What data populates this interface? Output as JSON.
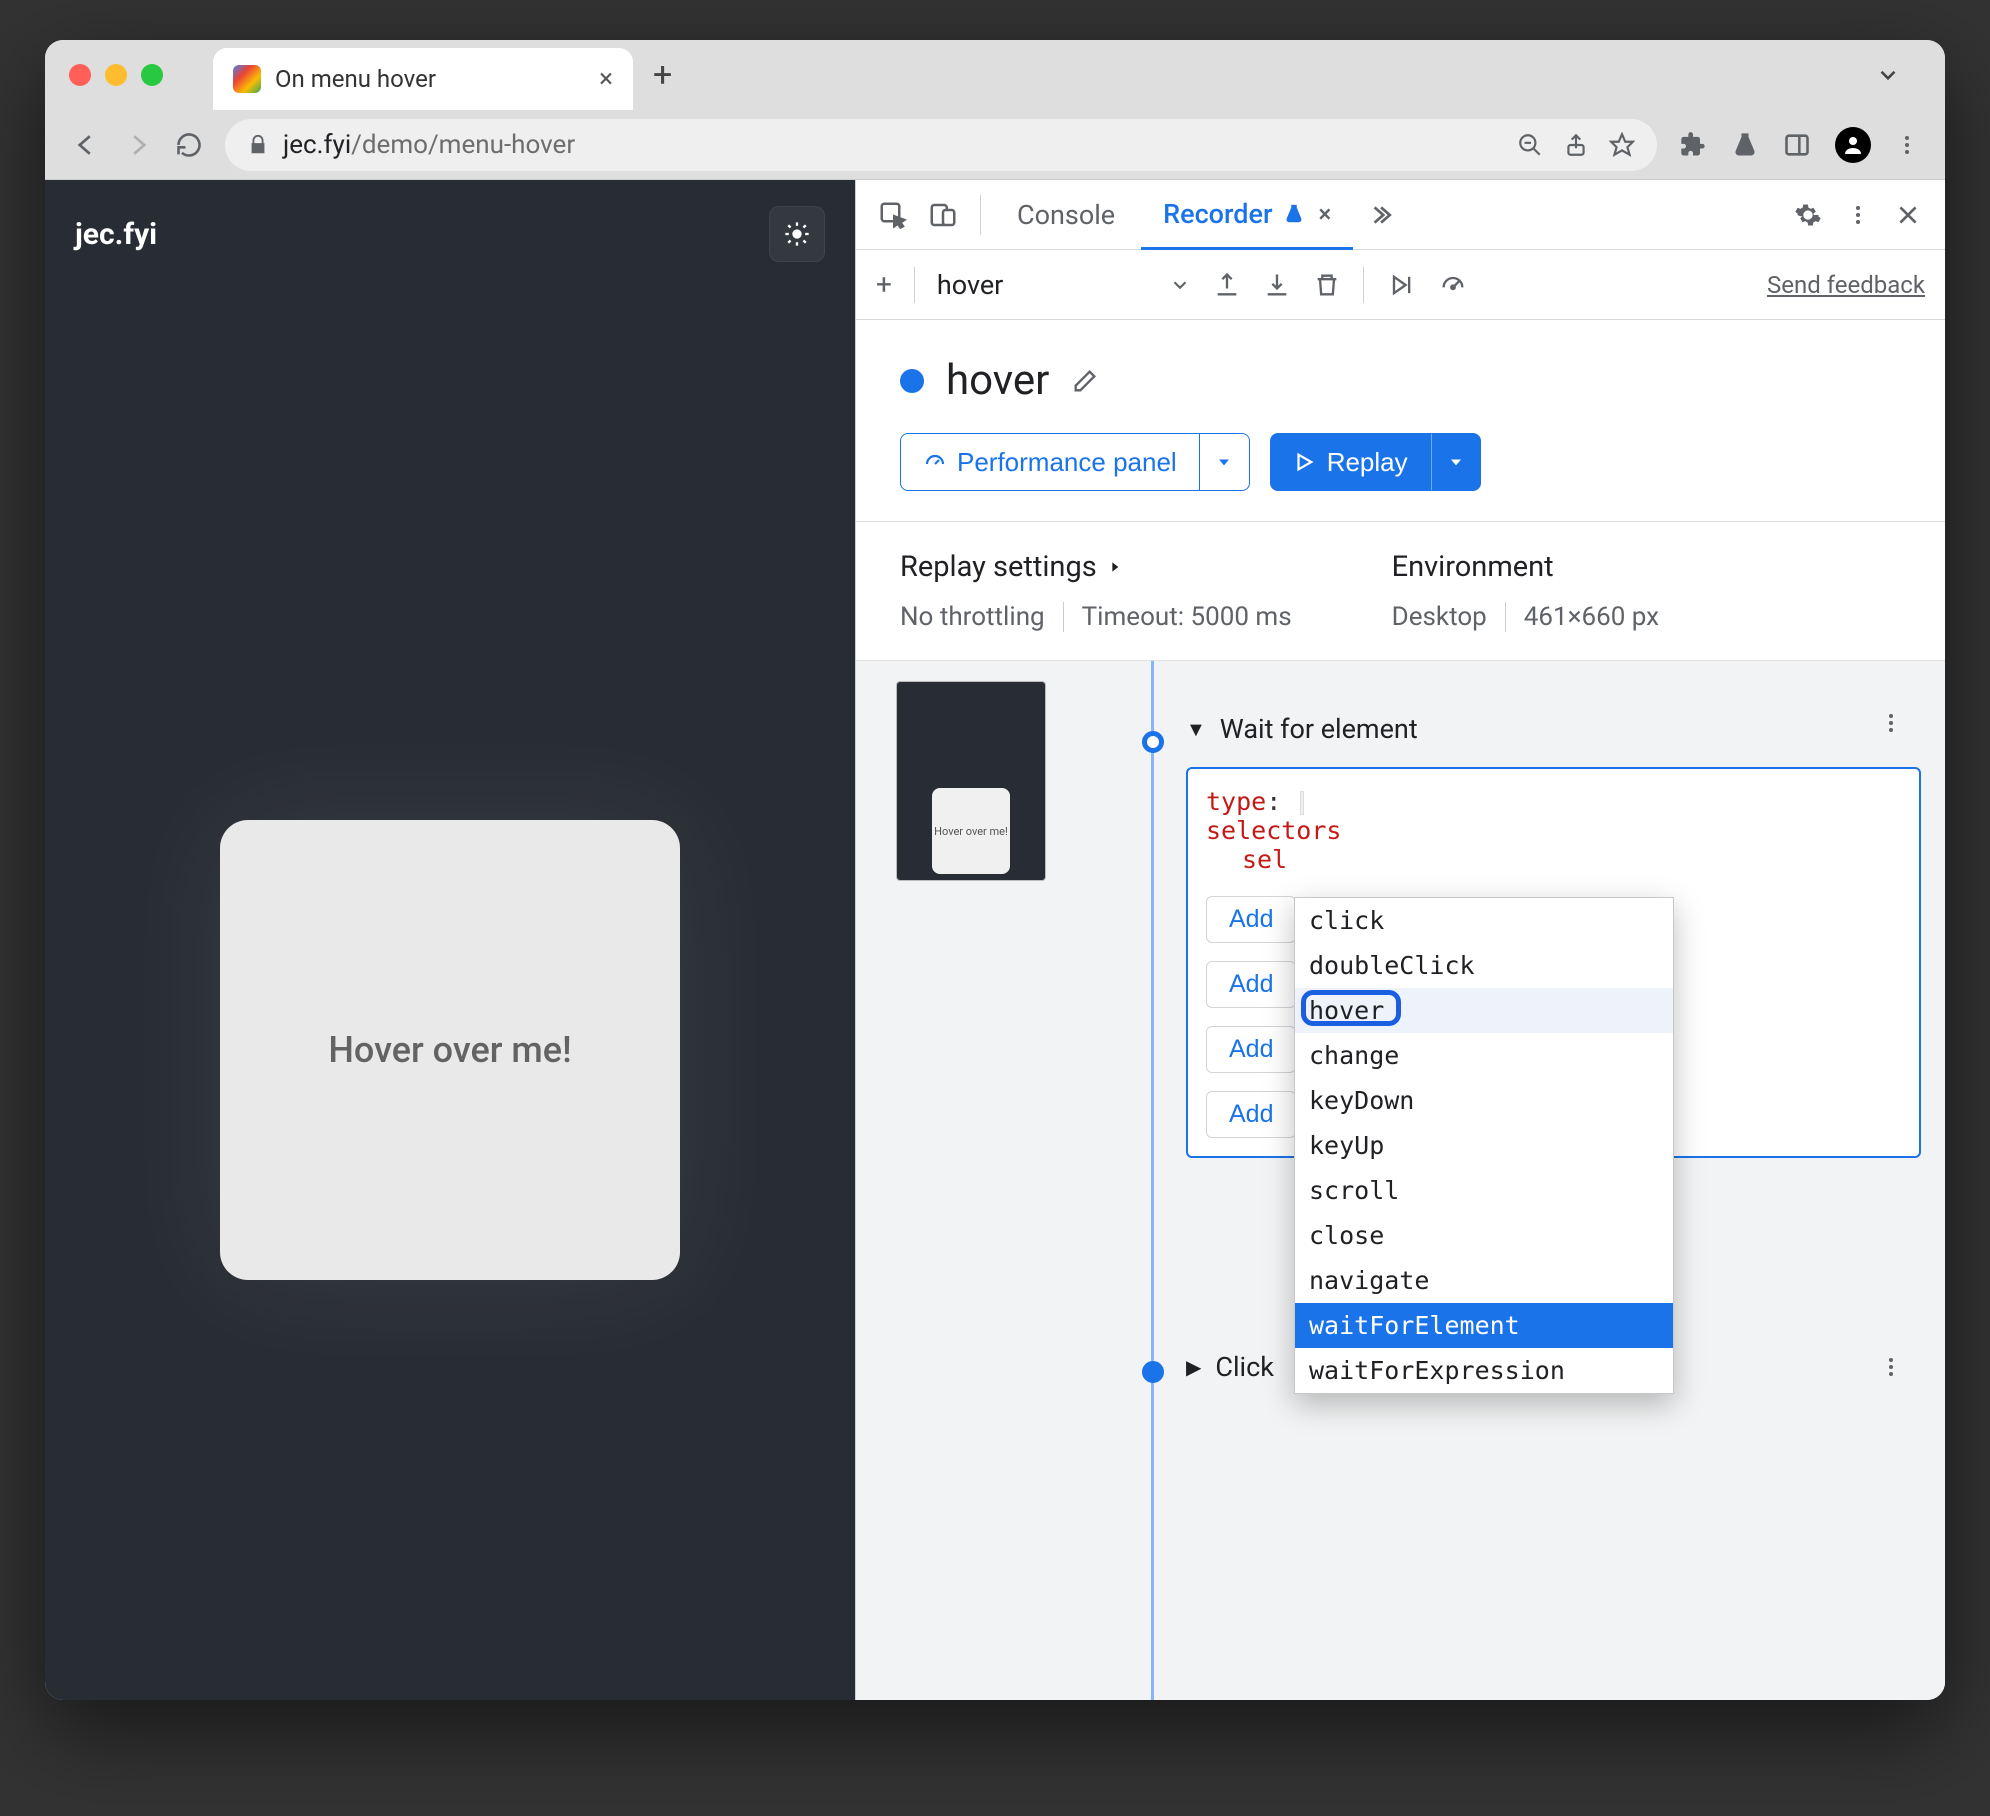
{
  "browser": {
    "tab_title": "On menu hover",
    "url_host": "jec.fyi",
    "url_path": "/demo/menu-hover"
  },
  "page": {
    "site_name": "jec.fyi",
    "card_text": "Hover over me!"
  },
  "devtools": {
    "tabs": {
      "console": "Console",
      "recorder": "Recorder"
    },
    "recording_select": "hover",
    "feedback": "Send feedback"
  },
  "recorder": {
    "title": "hover",
    "perf_btn": "Performance panel",
    "replay_btn": "Replay",
    "replay_settings_label": "Replay settings",
    "throttling": "No throttling",
    "timeout": "Timeout: 5000 ms",
    "env_label": "Environment",
    "env_device": "Desktop",
    "env_viewport": "461×660 px",
    "thumb_text": "Hover over me!"
  },
  "step": {
    "wait_title": "Wait for element",
    "click_title": "Click",
    "type_key": "type",
    "selectors_key": "selectors",
    "sel_key": "sel",
    "add_btn": "Add"
  },
  "autocomplete": {
    "options": [
      "click",
      "doubleClick",
      "hover",
      "change",
      "keyDown",
      "keyUp",
      "scroll",
      "close",
      "navigate",
      "waitForElement",
      "waitForExpression"
    ],
    "marked_index": 2,
    "selected_index": 9
  }
}
